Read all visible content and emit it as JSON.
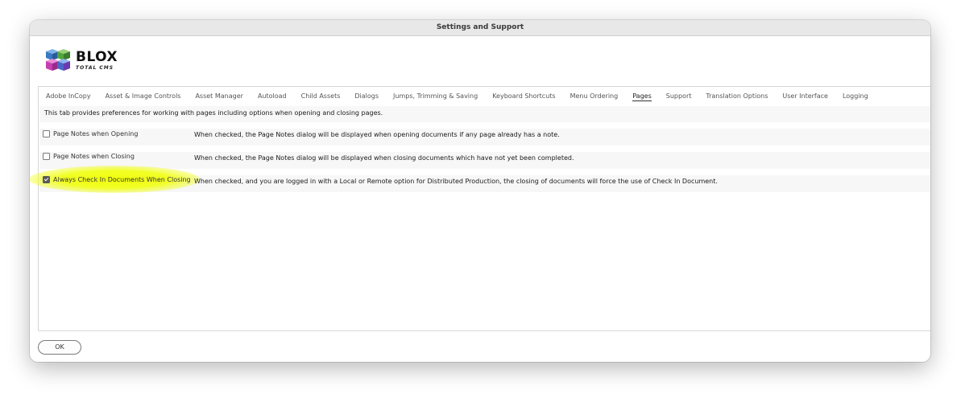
{
  "window": {
    "title": "Settings and Support"
  },
  "logo": {
    "main_text": "BLOX",
    "sub_text": "TOTAL CMS"
  },
  "tabs": [
    {
      "label": "Adobe InCopy",
      "active": false
    },
    {
      "label": "Asset & Image Controls",
      "active": false
    },
    {
      "label": "Asset Manager",
      "active": false
    },
    {
      "label": "Autoload",
      "active": false
    },
    {
      "label": "Child Assets",
      "active": false
    },
    {
      "label": "Dialogs",
      "active": false
    },
    {
      "label": "Jumps, Trimming & Saving",
      "active": false
    },
    {
      "label": "Keyboard Shortcuts",
      "active": false
    },
    {
      "label": "Menu Ordering",
      "active": false
    },
    {
      "label": "Pages",
      "active": true
    },
    {
      "label": "Support",
      "active": false
    },
    {
      "label": "Translation Options",
      "active": false
    },
    {
      "label": "User Interface",
      "active": false
    },
    {
      "label": "Logging",
      "active": false
    }
  ],
  "pages": {
    "description": "This tab provides preferences for working with pages including options when opening and closing pages.",
    "options": [
      {
        "label": "Page Notes when Opening",
        "checked": false,
        "description": "When checked, the Page Notes dialog will be displayed when opening documents if any page already has a note."
      },
      {
        "label": "Page Notes when Closing",
        "checked": false,
        "description": "When checked, the Page Notes dialog will be displayed when closing documents which have not yet been completed."
      },
      {
        "label": "Always Check In Documents When Closing",
        "checked": true,
        "description": "When checked, and you are logged in with a Local or Remote option for Distributed Production, the closing of documents will force the use of Check In Document."
      }
    ]
  },
  "buttons": {
    "ok_label": "OK"
  },
  "colors": {
    "highlight": "#f0ff00",
    "tab_active_underline": "#333333"
  }
}
